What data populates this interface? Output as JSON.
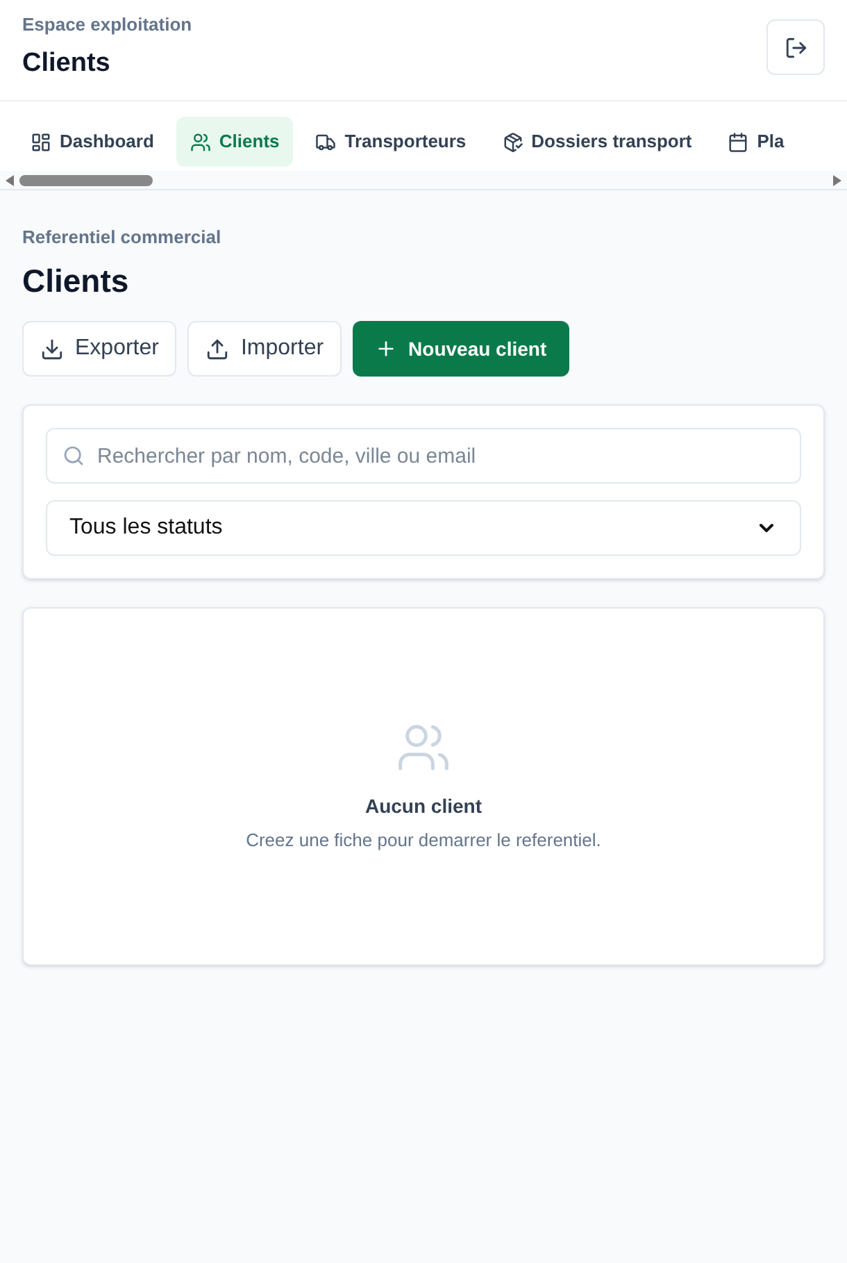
{
  "header": {
    "subtitle": "Espace exploitation",
    "title": "Clients"
  },
  "tabs": [
    {
      "label": "Dashboard",
      "kind": "dashboard",
      "selected": false
    },
    {
      "label": "Clients",
      "kind": "clients",
      "selected": true
    },
    {
      "label": "Transporteurs",
      "kind": "carriers",
      "selected": false
    },
    {
      "label": "Dossiers transport",
      "kind": "files",
      "selected": false
    },
    {
      "label": "Pla",
      "kind": "planning",
      "selected": false
    }
  ],
  "page": {
    "eyebrow": "Referentiel commercial",
    "title": "Clients"
  },
  "actions": [
    {
      "label": "Exporter",
      "kind": "export"
    },
    {
      "label": "Importer",
      "kind": "import"
    },
    {
      "label": "Nouveau client",
      "kind": "primary"
    }
  ],
  "filters": {
    "search_placeholder": "Rechercher par nom, code, ville ou email",
    "status": "Tous les statuts"
  },
  "empty_state": {
    "title": "Aucun client",
    "message": "Creez une fiche pour demarrer le referentiel."
  }
}
